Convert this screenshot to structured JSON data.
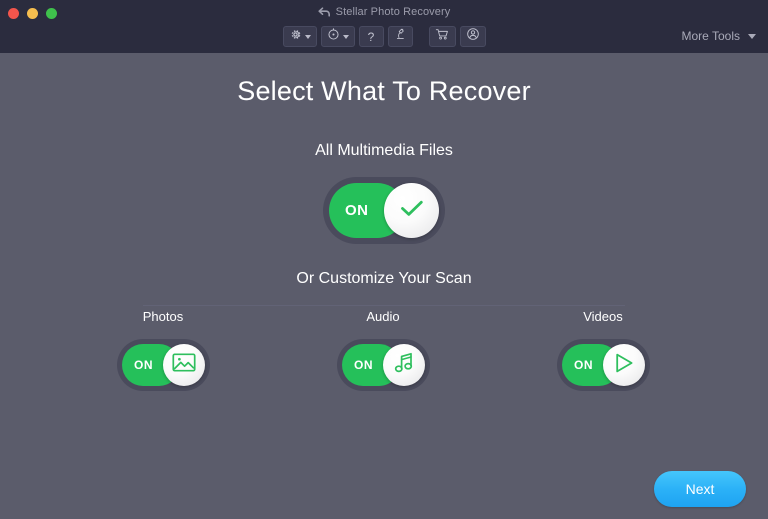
{
  "window": {
    "title": "Stellar Photo Recovery",
    "title_icon": "back-arrow-icon",
    "traffic_lights": [
      {
        "name": "close",
        "color": "#f3554c"
      },
      {
        "name": "minimize",
        "color": "#f6be4f"
      },
      {
        "name": "zoom",
        "color": "#3fc14c"
      }
    ]
  },
  "toolbar": {
    "buttons": [
      {
        "name": "settings",
        "icon": "gear-icon",
        "has_caret": true
      },
      {
        "name": "recovery-history",
        "icon": "history-clock-icon",
        "has_caret": true
      },
      {
        "name": "help",
        "icon": "question-mark-icon",
        "glyph": "?",
        "has_caret": false
      },
      {
        "name": "monitor-drive",
        "icon": "microscope-icon",
        "has_caret": false
      },
      {
        "name": "buy-now",
        "icon": "shopping-cart-icon",
        "has_caret": false
      },
      {
        "name": "account",
        "icon": "user-account-icon",
        "has_caret": false
      }
    ],
    "more_tools_label": "More Tools"
  },
  "main": {
    "page_title": "Select What To Recover",
    "all_media": {
      "label": "All Multimedia Files",
      "toggle_state": "ON",
      "icon": "checkmark-icon"
    },
    "customize_label": "Or Customize Your Scan",
    "categories": [
      {
        "label": "Photos",
        "toggle_state": "ON",
        "icon": "image-icon"
      },
      {
        "label": "Audio",
        "toggle_state": "ON",
        "icon": "music-note-icon"
      },
      {
        "label": "Videos",
        "toggle_state": "ON",
        "icon": "play-triangle-icon"
      }
    ]
  },
  "footer": {
    "next_label": "Next"
  },
  "colors": {
    "titlebar_bg": "#2b2c3e",
    "body_bg": "#5b5c6b",
    "toggle_track": "#4a4b5c",
    "toggle_on_green": "#25c05a",
    "accent_green": "#2fbf5e",
    "next_blue": "#2bb1f7",
    "text_white": "#ffffff"
  }
}
